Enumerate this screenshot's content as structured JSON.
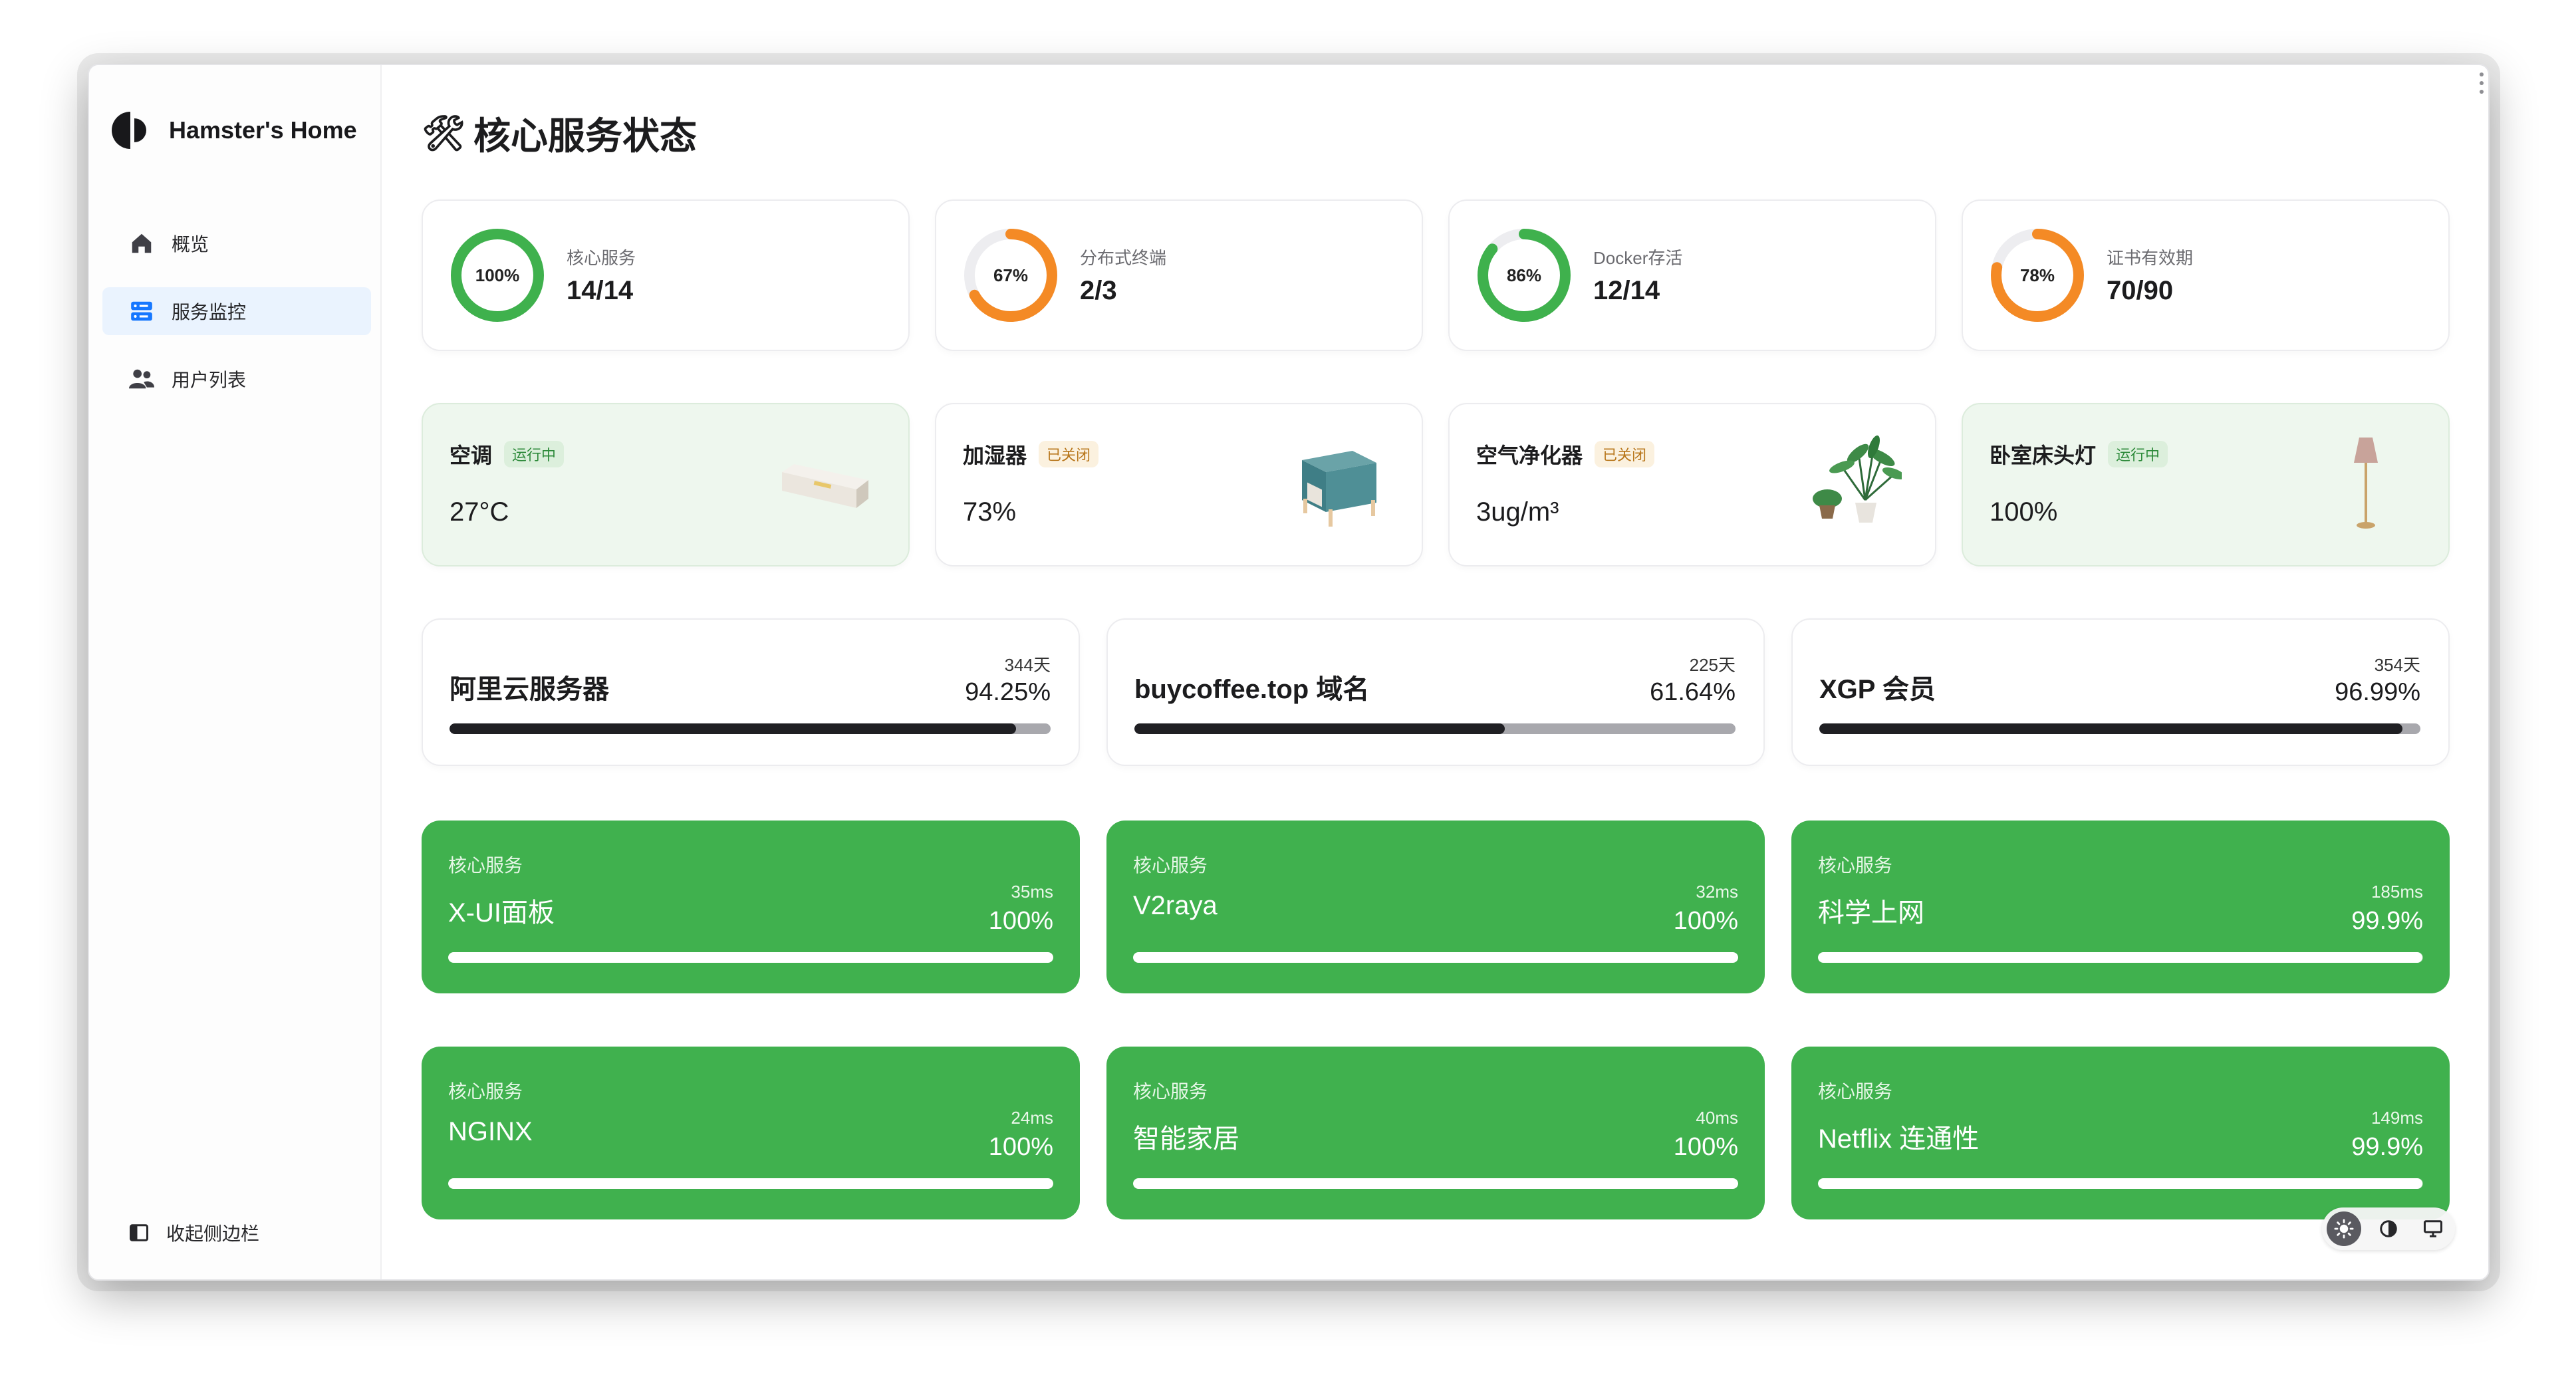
{
  "brand": {
    "name": "Hamster's Home"
  },
  "nav": [
    {
      "label": "概览",
      "icon": "home-icon",
      "active": false
    },
    {
      "label": "服务监控",
      "icon": "server-icon",
      "active": true
    },
    {
      "label": "用户列表",
      "icon": "users-icon",
      "active": false
    }
  ],
  "sidebar": {
    "collapse_label": "收起侧边栏"
  },
  "page": {
    "title_emoji": "🛠",
    "title": "核心服务状态"
  },
  "stats": [
    {
      "label": "核心服务",
      "value": "14/14",
      "percent_label": "100%",
      "percent": 100,
      "color": "#3fb14d"
    },
    {
      "label": "分布式终端",
      "value": "2/3",
      "percent_label": "67%",
      "percent": 67,
      "color": "#f48a25"
    },
    {
      "label": "Docker存活",
      "value": "12/14",
      "percent_label": "86%",
      "percent": 86,
      "color": "#3fb14d"
    },
    {
      "label": "证书有效期",
      "value": "70/90",
      "percent_label": "78%",
      "percent": 78,
      "color": "#f48a25"
    }
  ],
  "devices": [
    {
      "name": "空调",
      "status": "运行中",
      "on": true,
      "value": "27°C",
      "image": "air-conditioner-icon"
    },
    {
      "name": "加湿器",
      "status": "已关闭",
      "on": false,
      "value": "73%",
      "image": "humidifier-icon"
    },
    {
      "name": "空气净化器",
      "status": "已关闭",
      "on": false,
      "value": "3ug/m³",
      "image": "plant-icon"
    },
    {
      "name": "卧室床头灯",
      "status": "运行中",
      "on": true,
      "value": "100%",
      "image": "floor-lamp-icon"
    }
  ],
  "subscriptions": [
    {
      "name": "阿里云服务器",
      "days": "344天",
      "percent_label": "94.25%",
      "percent": 94.25
    },
    {
      "name": "buycoffee.top 域名",
      "days": "225天",
      "percent_label": "61.64%",
      "percent": 61.64
    },
    {
      "name": "XGP 会员",
      "days": "354天",
      "percent_label": "96.99%",
      "percent": 96.99
    }
  ],
  "services": [
    {
      "tag": "核心服务",
      "name": "X-UI面板",
      "latency": "35ms",
      "uptime_label": "100%",
      "uptime": 100
    },
    {
      "tag": "核心服务",
      "name": "V2raya",
      "latency": "32ms",
      "uptime_label": "100%",
      "uptime": 100
    },
    {
      "tag": "核心服务",
      "name": "科学上网",
      "latency": "185ms",
      "uptime_label": "99.9%",
      "uptime": 99.9
    },
    {
      "tag": "核心服务",
      "name": "NGINX",
      "latency": "24ms",
      "uptime_label": "100%",
      "uptime": 100
    },
    {
      "tag": "核心服务",
      "name": "智能家居",
      "latency": "40ms",
      "uptime_label": "100%",
      "uptime": 100
    },
    {
      "tag": "核心服务",
      "name": "Netflix 连通性",
      "latency": "149ms",
      "uptime_label": "99.9%",
      "uptime": 99.9
    }
  ],
  "theme": {
    "options": [
      "sun-icon",
      "moon-icon",
      "monitor-icon"
    ],
    "active": "sun-icon"
  }
}
